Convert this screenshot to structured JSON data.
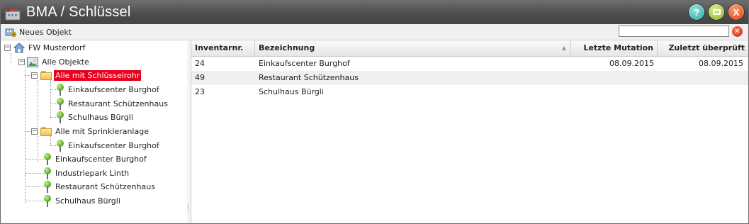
{
  "window": {
    "title": "BMA / Schlüssel",
    "buttons": [
      "help-button",
      "restore-button",
      "close-button"
    ],
    "help_glyph": "?",
    "close_glyph": "X"
  },
  "toolbar": {
    "new_object_label": "Neues Objekt",
    "search_value": "",
    "clear_glyph": "✕"
  },
  "tree": {
    "root": "FW Musterdorf",
    "all_objects": "Alle Objekte",
    "folder1": {
      "label": "Alle mit Schlüsselrohr",
      "items": [
        "Einkaufscenter Burghof",
        "Restaurant Schützenhaus",
        "Schulhaus Bürgli"
      ]
    },
    "folder2": {
      "label": "Alle mit Sprinkleranlage",
      "items": [
        "Einkaufscenter Burghof"
      ]
    },
    "objects": [
      "Einkaufscenter Burghof",
      "Industriepark Linth",
      "Restaurant Schützenhaus",
      "Schulhaus Bürgli"
    ],
    "expander_glyph": "−"
  },
  "grid": {
    "columns": [
      "Inventarnr.",
      "Bezeichnung",
      "Letzte Mutation",
      "Zuletzt überprüft"
    ],
    "sort_glyph": "▲",
    "rows": [
      {
        "inv": "24",
        "name": "Einkaufscenter Burghof",
        "mut": "08.09.2015",
        "chk": "08.09.2015"
      },
      {
        "inv": "49",
        "name": "Restaurant Schützenhaus",
        "mut": "",
        "chk": ""
      },
      {
        "inv": "23",
        "name": "Schulhaus Bürgli",
        "mut": "",
        "chk": ""
      }
    ]
  },
  "colors": {
    "selected": "#e8001c",
    "titlebar": "#555555",
    "help": "#39b5b0",
    "restore": "#9bc12c",
    "close": "#e04a16"
  }
}
